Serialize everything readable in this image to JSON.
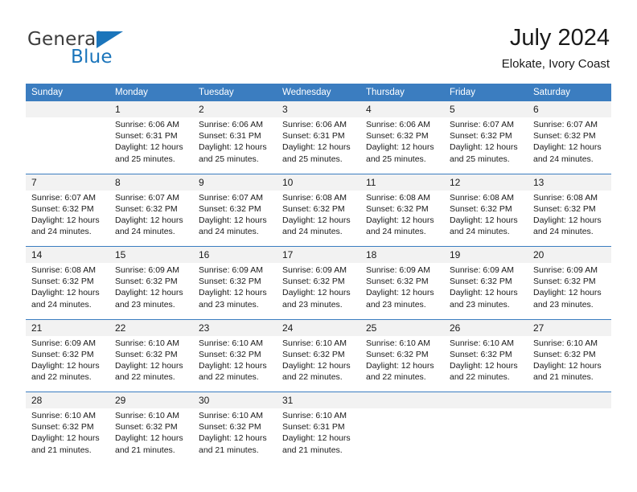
{
  "brand": {
    "name_part1": "General",
    "name_part2": "Blue",
    "triangle_color": "#1b75bb"
  },
  "header": {
    "title": "July 2024",
    "subtitle": "Elokate, Ivory Coast",
    "header_bg": "#3b7dc0",
    "daynum_bg": "#f2f2f2"
  },
  "weekdays": [
    "Sunday",
    "Monday",
    "Tuesday",
    "Wednesday",
    "Thursday",
    "Friday",
    "Saturday"
  ],
  "weeks": [
    [
      {
        "day": "",
        "lines": []
      },
      {
        "day": "1",
        "lines": [
          "Sunrise: 6:06 AM",
          "Sunset: 6:31 PM",
          "Daylight: 12 hours",
          "and 25 minutes."
        ]
      },
      {
        "day": "2",
        "lines": [
          "Sunrise: 6:06 AM",
          "Sunset: 6:31 PM",
          "Daylight: 12 hours",
          "and 25 minutes."
        ]
      },
      {
        "day": "3",
        "lines": [
          "Sunrise: 6:06 AM",
          "Sunset: 6:31 PM",
          "Daylight: 12 hours",
          "and 25 minutes."
        ]
      },
      {
        "day": "4",
        "lines": [
          "Sunrise: 6:06 AM",
          "Sunset: 6:32 PM",
          "Daylight: 12 hours",
          "and 25 minutes."
        ]
      },
      {
        "day": "5",
        "lines": [
          "Sunrise: 6:07 AM",
          "Sunset: 6:32 PM",
          "Daylight: 12 hours",
          "and 25 minutes."
        ]
      },
      {
        "day": "6",
        "lines": [
          "Sunrise: 6:07 AM",
          "Sunset: 6:32 PM",
          "Daylight: 12 hours",
          "and 24 minutes."
        ]
      }
    ],
    [
      {
        "day": "7",
        "lines": [
          "Sunrise: 6:07 AM",
          "Sunset: 6:32 PM",
          "Daylight: 12 hours",
          "and 24 minutes."
        ]
      },
      {
        "day": "8",
        "lines": [
          "Sunrise: 6:07 AM",
          "Sunset: 6:32 PM",
          "Daylight: 12 hours",
          "and 24 minutes."
        ]
      },
      {
        "day": "9",
        "lines": [
          "Sunrise: 6:07 AM",
          "Sunset: 6:32 PM",
          "Daylight: 12 hours",
          "and 24 minutes."
        ]
      },
      {
        "day": "10",
        "lines": [
          "Sunrise: 6:08 AM",
          "Sunset: 6:32 PM",
          "Daylight: 12 hours",
          "and 24 minutes."
        ]
      },
      {
        "day": "11",
        "lines": [
          "Sunrise: 6:08 AM",
          "Sunset: 6:32 PM",
          "Daylight: 12 hours",
          "and 24 minutes."
        ]
      },
      {
        "day": "12",
        "lines": [
          "Sunrise: 6:08 AM",
          "Sunset: 6:32 PM",
          "Daylight: 12 hours",
          "and 24 minutes."
        ]
      },
      {
        "day": "13",
        "lines": [
          "Sunrise: 6:08 AM",
          "Sunset: 6:32 PM",
          "Daylight: 12 hours",
          "and 24 minutes."
        ]
      }
    ],
    [
      {
        "day": "14",
        "lines": [
          "Sunrise: 6:08 AM",
          "Sunset: 6:32 PM",
          "Daylight: 12 hours",
          "and 24 minutes."
        ]
      },
      {
        "day": "15",
        "lines": [
          "Sunrise: 6:09 AM",
          "Sunset: 6:32 PM",
          "Daylight: 12 hours",
          "and 23 minutes."
        ]
      },
      {
        "day": "16",
        "lines": [
          "Sunrise: 6:09 AM",
          "Sunset: 6:32 PM",
          "Daylight: 12 hours",
          "and 23 minutes."
        ]
      },
      {
        "day": "17",
        "lines": [
          "Sunrise: 6:09 AM",
          "Sunset: 6:32 PM",
          "Daylight: 12 hours",
          "and 23 minutes."
        ]
      },
      {
        "day": "18",
        "lines": [
          "Sunrise: 6:09 AM",
          "Sunset: 6:32 PM",
          "Daylight: 12 hours",
          "and 23 minutes."
        ]
      },
      {
        "day": "19",
        "lines": [
          "Sunrise: 6:09 AM",
          "Sunset: 6:32 PM",
          "Daylight: 12 hours",
          "and 23 minutes."
        ]
      },
      {
        "day": "20",
        "lines": [
          "Sunrise: 6:09 AM",
          "Sunset: 6:32 PM",
          "Daylight: 12 hours",
          "and 23 minutes."
        ]
      }
    ],
    [
      {
        "day": "21",
        "lines": [
          "Sunrise: 6:09 AM",
          "Sunset: 6:32 PM",
          "Daylight: 12 hours",
          "and 22 minutes."
        ]
      },
      {
        "day": "22",
        "lines": [
          "Sunrise: 6:10 AM",
          "Sunset: 6:32 PM",
          "Daylight: 12 hours",
          "and 22 minutes."
        ]
      },
      {
        "day": "23",
        "lines": [
          "Sunrise: 6:10 AM",
          "Sunset: 6:32 PM",
          "Daylight: 12 hours",
          "and 22 minutes."
        ]
      },
      {
        "day": "24",
        "lines": [
          "Sunrise: 6:10 AM",
          "Sunset: 6:32 PM",
          "Daylight: 12 hours",
          "and 22 minutes."
        ]
      },
      {
        "day": "25",
        "lines": [
          "Sunrise: 6:10 AM",
          "Sunset: 6:32 PM",
          "Daylight: 12 hours",
          "and 22 minutes."
        ]
      },
      {
        "day": "26",
        "lines": [
          "Sunrise: 6:10 AM",
          "Sunset: 6:32 PM",
          "Daylight: 12 hours",
          "and 22 minutes."
        ]
      },
      {
        "day": "27",
        "lines": [
          "Sunrise: 6:10 AM",
          "Sunset: 6:32 PM",
          "Daylight: 12 hours",
          "and 21 minutes."
        ]
      }
    ],
    [
      {
        "day": "28",
        "lines": [
          "Sunrise: 6:10 AM",
          "Sunset: 6:32 PM",
          "Daylight: 12 hours",
          "and 21 minutes."
        ]
      },
      {
        "day": "29",
        "lines": [
          "Sunrise: 6:10 AM",
          "Sunset: 6:32 PM",
          "Daylight: 12 hours",
          "and 21 minutes."
        ]
      },
      {
        "day": "30",
        "lines": [
          "Sunrise: 6:10 AM",
          "Sunset: 6:32 PM",
          "Daylight: 12 hours",
          "and 21 minutes."
        ]
      },
      {
        "day": "31",
        "lines": [
          "Sunrise: 6:10 AM",
          "Sunset: 6:31 PM",
          "Daylight: 12 hours",
          "and 21 minutes."
        ]
      },
      {
        "day": "",
        "lines": []
      },
      {
        "day": "",
        "lines": []
      },
      {
        "day": "",
        "lines": []
      }
    ]
  ]
}
